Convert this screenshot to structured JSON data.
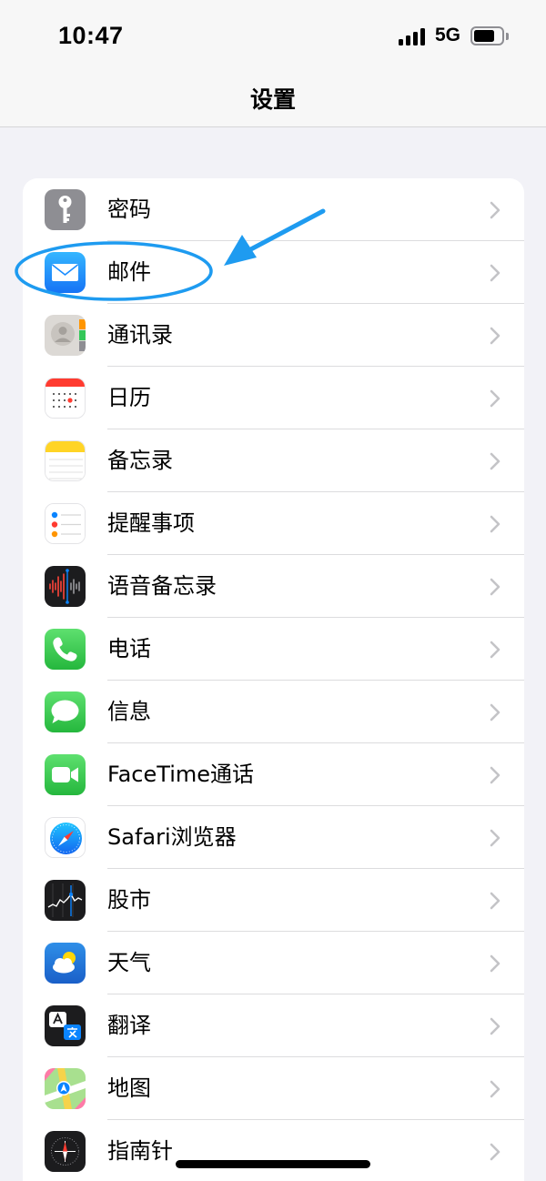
{
  "status_bar": {
    "time": "10:47",
    "network": "5G",
    "icons": [
      "cellular-signal-icon",
      "battery-icon"
    ]
  },
  "nav": {
    "title": "设置"
  },
  "settings": {
    "items": [
      {
        "label": "密码",
        "icon": "key-icon",
        "color": "#8e8e93"
      },
      {
        "label": "邮件",
        "icon": "mail-icon",
        "color": "#1a8cff"
      },
      {
        "label": "通讯录",
        "icon": "contacts-icon",
        "color": "#d9d6d2"
      },
      {
        "label": "日历",
        "icon": "calendar-icon",
        "color": "#ffffff"
      },
      {
        "label": "备忘录",
        "icon": "notes-icon",
        "color": "#ffd60a"
      },
      {
        "label": "提醒事项",
        "icon": "reminders-icon",
        "color": "#ffffff"
      },
      {
        "label": "语音备忘录",
        "icon": "voice-memos-icon",
        "color": "#1c1c1e"
      },
      {
        "label": "电话",
        "icon": "phone-icon",
        "color": "#34c759"
      },
      {
        "label": "信息",
        "icon": "messages-icon",
        "color": "#34c759"
      },
      {
        "label": "FaceTime通话",
        "icon": "facetime-icon",
        "color": "#34c759"
      },
      {
        "label": "Safari浏览器",
        "icon": "safari-icon",
        "color": "#1a8cff"
      },
      {
        "label": "股市",
        "icon": "stocks-icon",
        "color": "#1c1c1e"
      },
      {
        "label": "天气",
        "icon": "weather-icon",
        "color": "#2f7fe0"
      },
      {
        "label": "翻译",
        "icon": "translate-icon",
        "color": "#1c1c1e"
      },
      {
        "label": "地图",
        "icon": "maps-icon",
        "color": "#7fd37a"
      },
      {
        "label": "指南针",
        "icon": "compass-icon",
        "color": "#1c1c1e"
      }
    ]
  },
  "annotation": {
    "highlight_target": "邮件",
    "color": "#1e9bf0"
  }
}
